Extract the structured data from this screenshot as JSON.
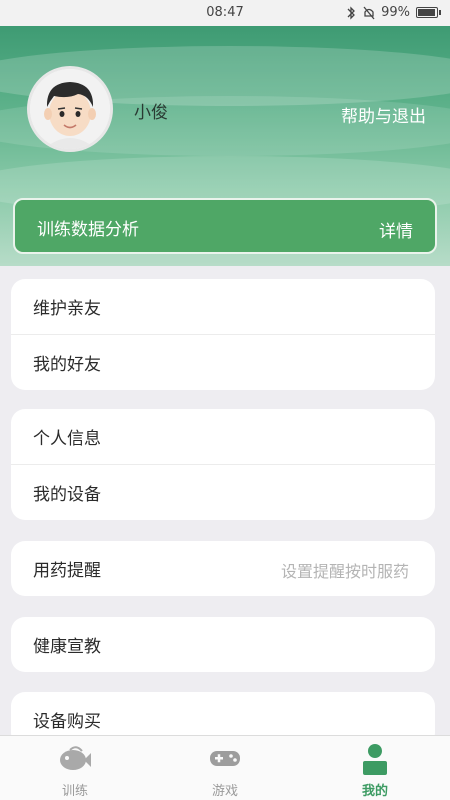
{
  "status_bar": {
    "time": "08:47",
    "battery": "99%"
  },
  "profile": {
    "username": "小俊",
    "help_logout_label": "帮助与退出"
  },
  "training_card": {
    "title": "训练数据分析",
    "detail_label": "详情"
  },
  "menu_groups": [
    {
      "items": [
        {
          "label": "维护亲友"
        },
        {
          "label": "我的好友"
        }
      ]
    },
    {
      "items": [
        {
          "label": "个人信息"
        },
        {
          "label": "我的设备"
        }
      ]
    },
    {
      "items": [
        {
          "label": "用药提醒",
          "hint": "设置提醒按时服药"
        }
      ]
    },
    {
      "items": [
        {
          "label": "健康宣教"
        }
      ]
    },
    {
      "items": [
        {
          "label": "设备购买"
        }
      ]
    }
  ],
  "bottom_nav": [
    {
      "label": "训练",
      "icon": "fish-icon",
      "active": false
    },
    {
      "label": "游戏",
      "icon": "gamepad-icon",
      "active": false
    },
    {
      "label": "我的",
      "icon": "person-icon",
      "active": true
    }
  ],
  "colors": {
    "accent_green": "#4fa766",
    "active_nav": "#3d9b63"
  }
}
